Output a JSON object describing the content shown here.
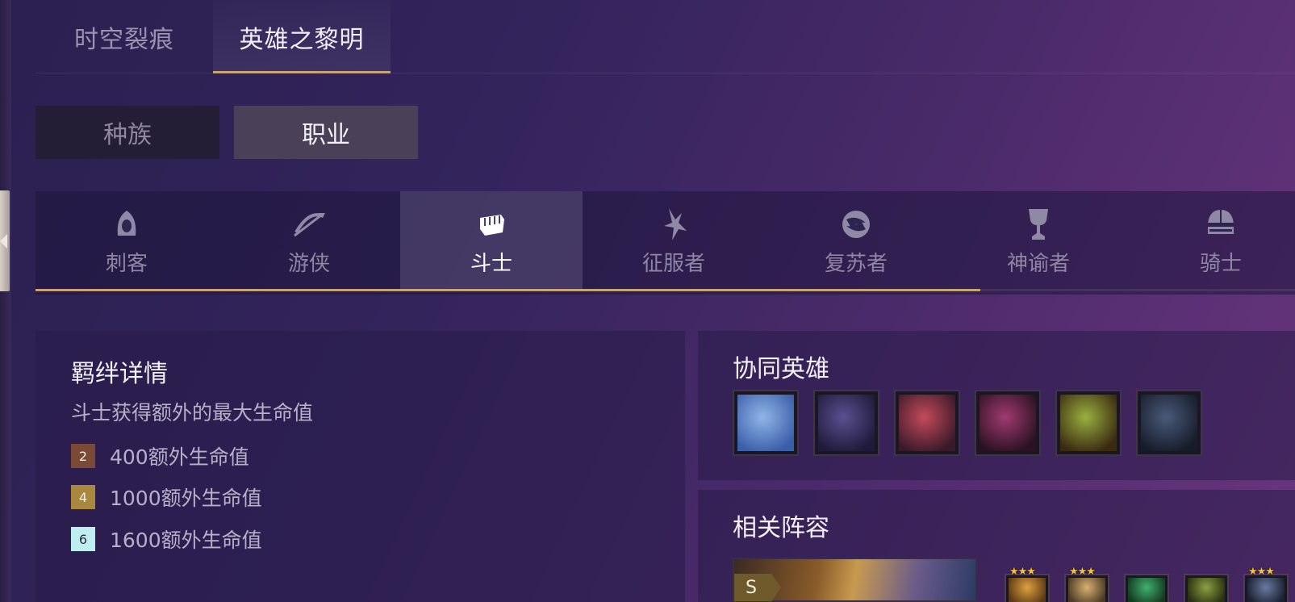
{
  "top_tabs": [
    {
      "label": "时空裂痕",
      "active": false
    },
    {
      "label": "英雄之黎明",
      "active": true
    }
  ],
  "segment": [
    {
      "label": "种族",
      "active": false
    },
    {
      "label": "职业",
      "active": true
    }
  ],
  "classes": [
    {
      "label": "刺客",
      "icon": "hood-icon"
    },
    {
      "label": "游侠",
      "icon": "bow-icon"
    },
    {
      "label": "斗士",
      "icon": "fist-icon",
      "active": true
    },
    {
      "label": "征服者",
      "icon": "conqueror-icon"
    },
    {
      "label": "复苏者",
      "icon": "revenant-icon"
    },
    {
      "label": "神谕者",
      "icon": "chalice-icon"
    },
    {
      "label": "骑士",
      "icon": "helmet-icon"
    }
  ],
  "class_scroll_progress": 0.75,
  "bond": {
    "title": "羁绊详情",
    "description": "斗士获得额外的最大生命值",
    "tiers": [
      {
        "count": "2",
        "text": "400额外生命值",
        "color": "#7a4a36"
      },
      {
        "count": "4",
        "text": "1000额外生命值",
        "color": "#a8883e"
      },
      {
        "count": "6",
        "text": "1600额外生命值",
        "color": "#bfeef0"
      }
    ]
  },
  "heroes": {
    "title": "协同英雄",
    "portraits": [
      {
        "name": "hero-portrait-1",
        "colors": [
          "#8fb6e8",
          "#3b5ea8"
        ]
      },
      {
        "name": "hero-portrait-2",
        "colors": [
          "#5a5090",
          "#1f1a3a"
        ]
      },
      {
        "name": "hero-portrait-3",
        "colors": [
          "#c44a5a",
          "#3a1a2a"
        ]
      },
      {
        "name": "hero-portrait-4",
        "colors": [
          "#a03a70",
          "#2a1222"
        ]
      },
      {
        "name": "hero-portrait-5",
        "colors": [
          "#9ab040",
          "#3a2a10"
        ]
      },
      {
        "name": "hero-portrait-6",
        "colors": [
          "#4a5a7a",
          "#161c2a"
        ]
      }
    ]
  },
  "comps": {
    "title": "相关阵容",
    "rank": "S",
    "units": [
      {
        "stars": "★★★",
        "colors": [
          "#e0a040",
          "#5a3a14"
        ]
      },
      {
        "stars": "★★★",
        "colors": [
          "#d8b070",
          "#4a3a24"
        ]
      },
      {
        "stars": "",
        "colors": [
          "#40b070",
          "#123a20"
        ]
      },
      {
        "stars": "",
        "colors": [
          "#8aa040",
          "#2a3010"
        ]
      },
      {
        "stars": "★★★",
        "colors": [
          "#6a7aa0",
          "#1a2030"
        ]
      }
    ]
  }
}
